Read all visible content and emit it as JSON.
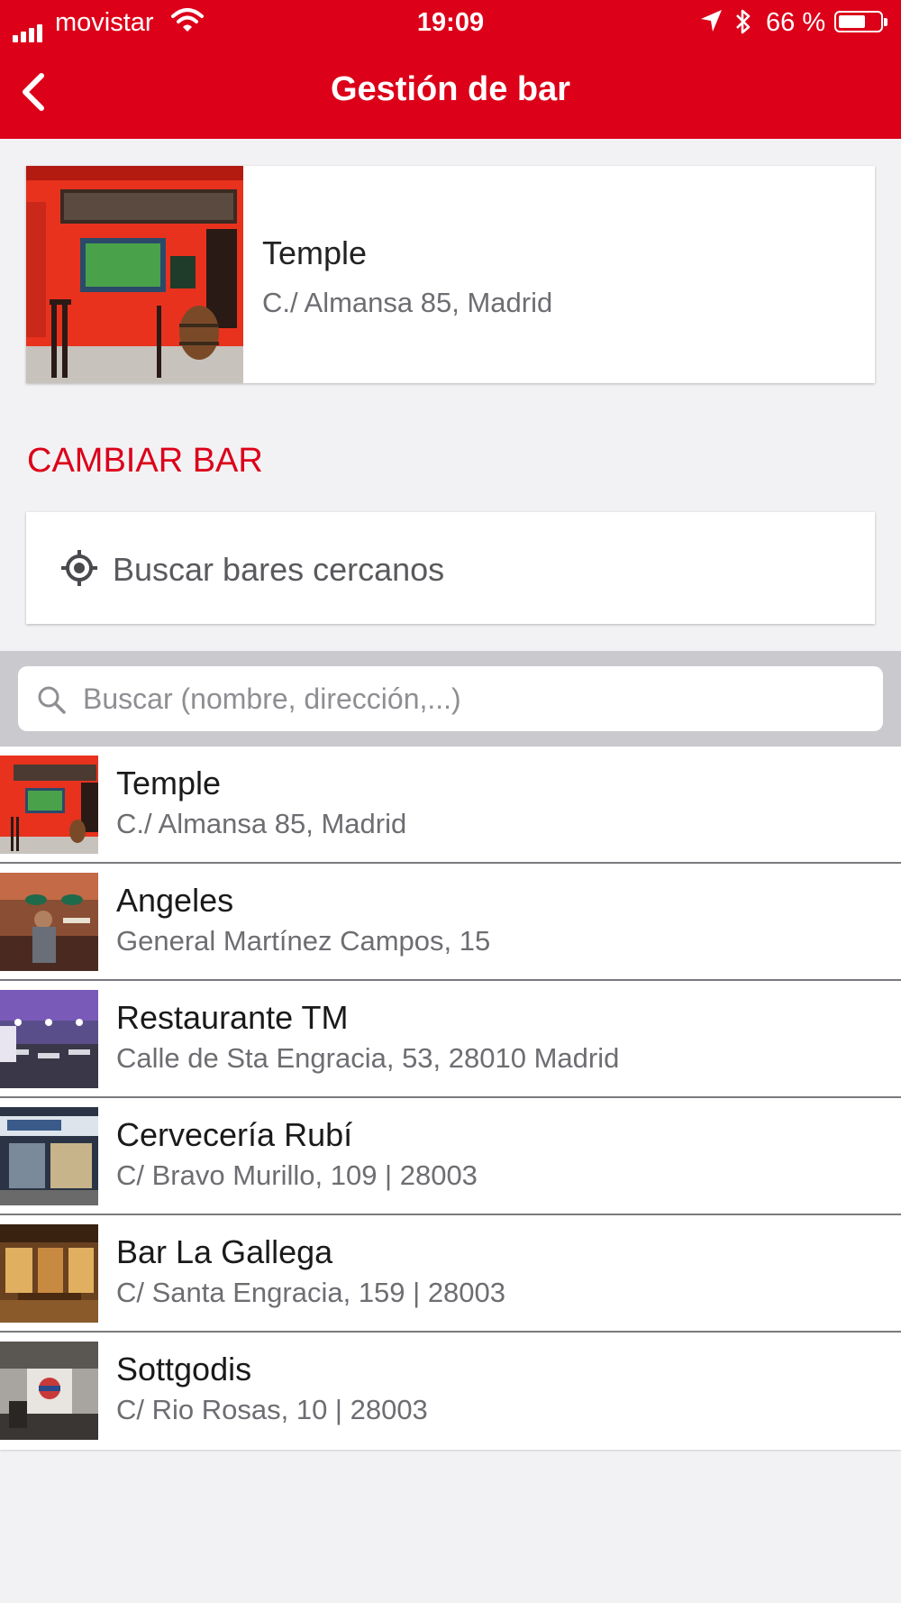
{
  "status_bar": {
    "carrier": "movistar",
    "time": "19:09",
    "battery": "66 %",
    "battery_level": 0.66
  },
  "header": {
    "title": "Gestión de bar",
    "bar_color": "#dc0019"
  },
  "current_bar": {
    "name": "Temple",
    "address": "C./ Almansa 85, Madrid"
  },
  "change_section": {
    "title": "CAMBIAR BAR",
    "nearby_label": "Buscar bares cercanos"
  },
  "search": {
    "placeholder": "Buscar (nombre, dirección,...)",
    "value": ""
  },
  "bars": [
    {
      "name": "Temple",
      "address": "C./ Almansa 85, Madrid"
    },
    {
      "name": "Angeles",
      "address": "General Martínez Campos, 15"
    },
    {
      "name": "Restaurante TM",
      "address": "Calle de Sta Engracia, 53, 28010 Madrid"
    },
    {
      "name": "Cervecería Rubí",
      "address": "C/ Bravo Murillo, 109 | 28003"
    },
    {
      "name": "Bar La Gallega",
      "address": "C/ Santa Engracia, 159 | 28003"
    },
    {
      "name": "Sottgodis",
      "address": "C/ Rio Rosas, 10 | 28003"
    }
  ]
}
